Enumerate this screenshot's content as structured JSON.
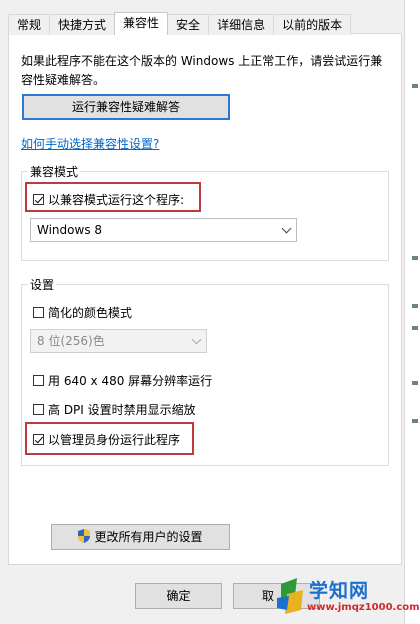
{
  "tabs": [
    {
      "label": "常规"
    },
    {
      "label": "快捷方式"
    },
    {
      "label": "兼容性"
    },
    {
      "label": "安全"
    },
    {
      "label": "详细信息"
    },
    {
      "label": "以前的版本"
    }
  ],
  "active_tab": "兼容性",
  "description": "如果此程序不能在这个版本的 Windows 上正常工作，请尝试运行兼容性疑难解答。",
  "troubleshoot_button": "运行兼容性疑难解答",
  "manual_link": "如何手动选择兼容性设置?",
  "compat_mode": {
    "title": "兼容模式",
    "checkbox_label": "以兼容模式运行这个程序:",
    "checked": true,
    "select_value": "Windows 8"
  },
  "settings": {
    "title": "设置",
    "reduced_color": {
      "label": "简化的颜色模式",
      "checked": false
    },
    "color_select": "8 位(256)色",
    "res_640": {
      "label": "用 640 x 480 屏幕分辨率运行",
      "checked": false
    },
    "high_dpi": {
      "label": "高 DPI 设置时禁用显示缩放",
      "checked": false
    },
    "run_admin": {
      "label": "以管理员身份运行此程序",
      "checked": true
    }
  },
  "change_all_users_button": "更改所有用户的设置",
  "ok_button": "确定",
  "cancel_button": "取",
  "watermark": {
    "brand": "学知网",
    "url": "www.jmqz1000.com"
  },
  "colors": {
    "highlight_red": "#c0393b",
    "link_blue": "#0066cc",
    "focus_blue": "#2a78d2"
  }
}
